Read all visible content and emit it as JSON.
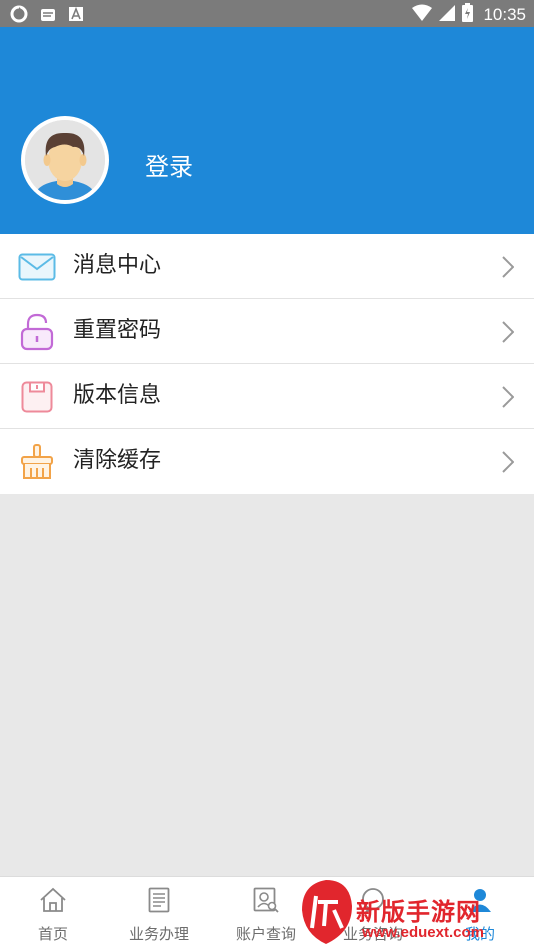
{
  "status_bar": {
    "time": "10:35"
  },
  "header": {
    "login_label": "登录"
  },
  "menu": {
    "items": [
      {
        "label": "消息中心",
        "icon": "mail-icon"
      },
      {
        "label": "重置密码",
        "icon": "lock-icon"
      },
      {
        "label": "版本信息",
        "icon": "save-icon"
      },
      {
        "label": "清除缓存",
        "icon": "broom-icon"
      }
    ]
  },
  "tab_bar": {
    "tabs": [
      {
        "label": "首页",
        "icon": "home-icon"
      },
      {
        "label": "业务办理",
        "icon": "document-icon"
      },
      {
        "label": "账户查询",
        "icon": "account-search-icon"
      },
      {
        "label": "业务咨询",
        "icon": "chat-icon"
      },
      {
        "label": "我的",
        "icon": "user-icon"
      }
    ]
  },
  "watermark": {
    "text": "新版手游网",
    "url": "www.eduext.com"
  },
  "colors": {
    "header": "#1e88d8",
    "status_bar": "#7b7b7b",
    "background": "#e8e8e8"
  }
}
